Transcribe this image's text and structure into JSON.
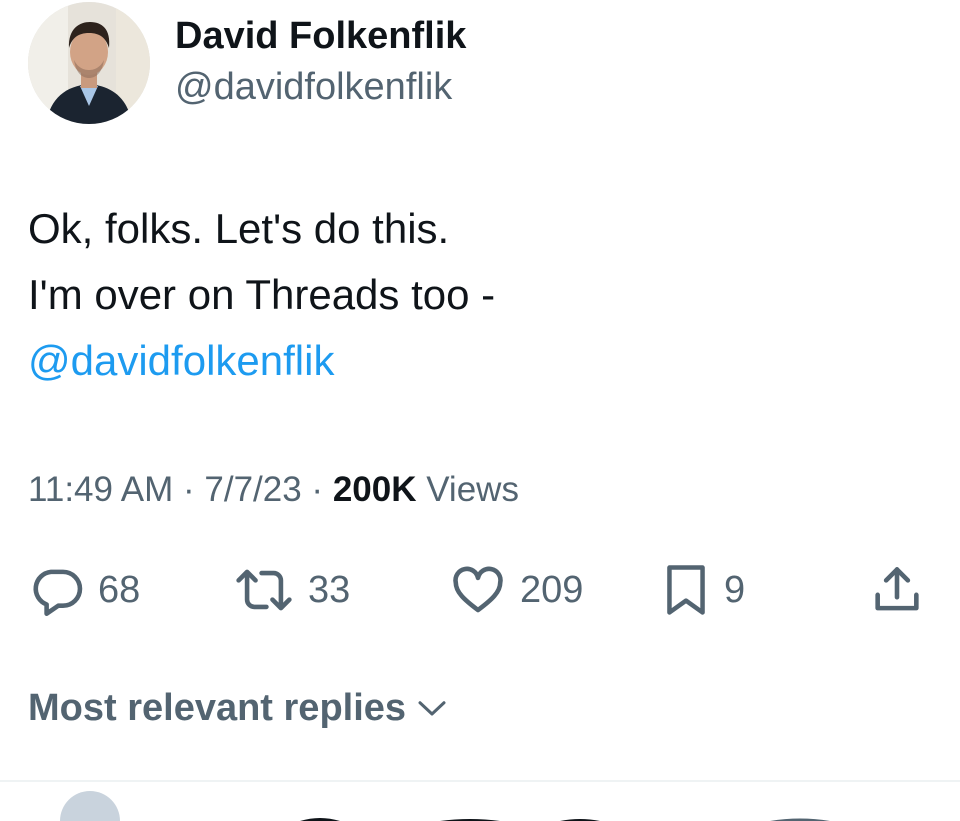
{
  "author": {
    "name": "David Folkenflik",
    "handle": "@davidfolkenflik"
  },
  "tweet": {
    "line1": "Ok, folks. Let's do this.",
    "line2": "I'm over on Threads too -",
    "mention": "@davidfolkenflik"
  },
  "meta": {
    "time": "11:49 AM",
    "sep1": " · ",
    "date": "7/7/23",
    "sep2": " · ",
    "views_count": "200K",
    "views_label": " Views"
  },
  "actions": {
    "replies": "68",
    "reposts": "33",
    "likes": "209",
    "bookmarks": "9"
  },
  "replies_sort": {
    "label": "Most relevant replies"
  },
  "colors": {
    "text": "#0f1419",
    "secondary": "#536471",
    "link": "#1d9bf0",
    "divider": "#eff3f4"
  },
  "icons": {
    "reply": "speech-bubble-icon",
    "repost": "repost-arrows-icon",
    "like": "heart-icon",
    "bookmark": "bookmark-icon",
    "share": "share-upload-icon",
    "sort": "chevron-down-icon"
  }
}
